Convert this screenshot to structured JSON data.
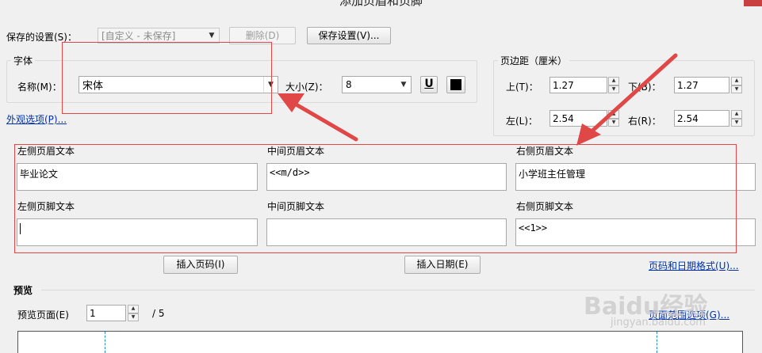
{
  "window": {
    "title": "添加页眉和页脚"
  },
  "saved_settings": {
    "label": "保存的设置(S)：",
    "combo_value": "[自定义 - 未保存]",
    "delete_label": "删除(D)",
    "save_label": "保存设置(V)..."
  },
  "font": {
    "group_title": "字体",
    "name_label": "名称(M)：",
    "name_value": "宋体",
    "size_label": "大小(Z)：",
    "size_value": "8",
    "underline_label": "U",
    "color": "#000000"
  },
  "appearance_link": "外观选项(P)...",
  "margins": {
    "group_title": "页边距（厘米）",
    "top_label": "上(T)：",
    "top_value": "1.27",
    "bottom_label": "下(B)：",
    "bottom_value": "1.27",
    "left_label": "左(L)：",
    "left_value": "2.54",
    "right_label": "右(R)：",
    "right_value": "2.54"
  },
  "header_footer": {
    "left_header_label": "左侧页眉文本",
    "left_header_value": "毕业论文",
    "center_header_label": "中间页眉文本",
    "center_header_value": "<<m/d>>",
    "right_header_label": "右侧页眉文本",
    "right_header_value": "小学班主任管理",
    "left_footer_label": "左侧页脚文本",
    "left_footer_value": "",
    "center_footer_label": "中间页脚文本",
    "center_footer_value": "",
    "right_footer_label": "右侧页脚文本",
    "right_footer_value": "<<1>>"
  },
  "insert": {
    "page_number_label": "插入页码(I)",
    "date_label": "插入日期(E)",
    "format_link": "页码和日期格式(U)..."
  },
  "preview": {
    "section_title": "预览",
    "page_label": "预览页面(E)",
    "page_value": "1",
    "total": "/ 5",
    "range_link": "页面范围选项(G)..."
  },
  "watermark": {
    "brand": "Baidu经验",
    "url": "jingyan.baidu.com"
  },
  "colors": {
    "annotation_red": "#e04848",
    "link_blue": "#0033aa",
    "guide_blue": "#2e86c1"
  }
}
